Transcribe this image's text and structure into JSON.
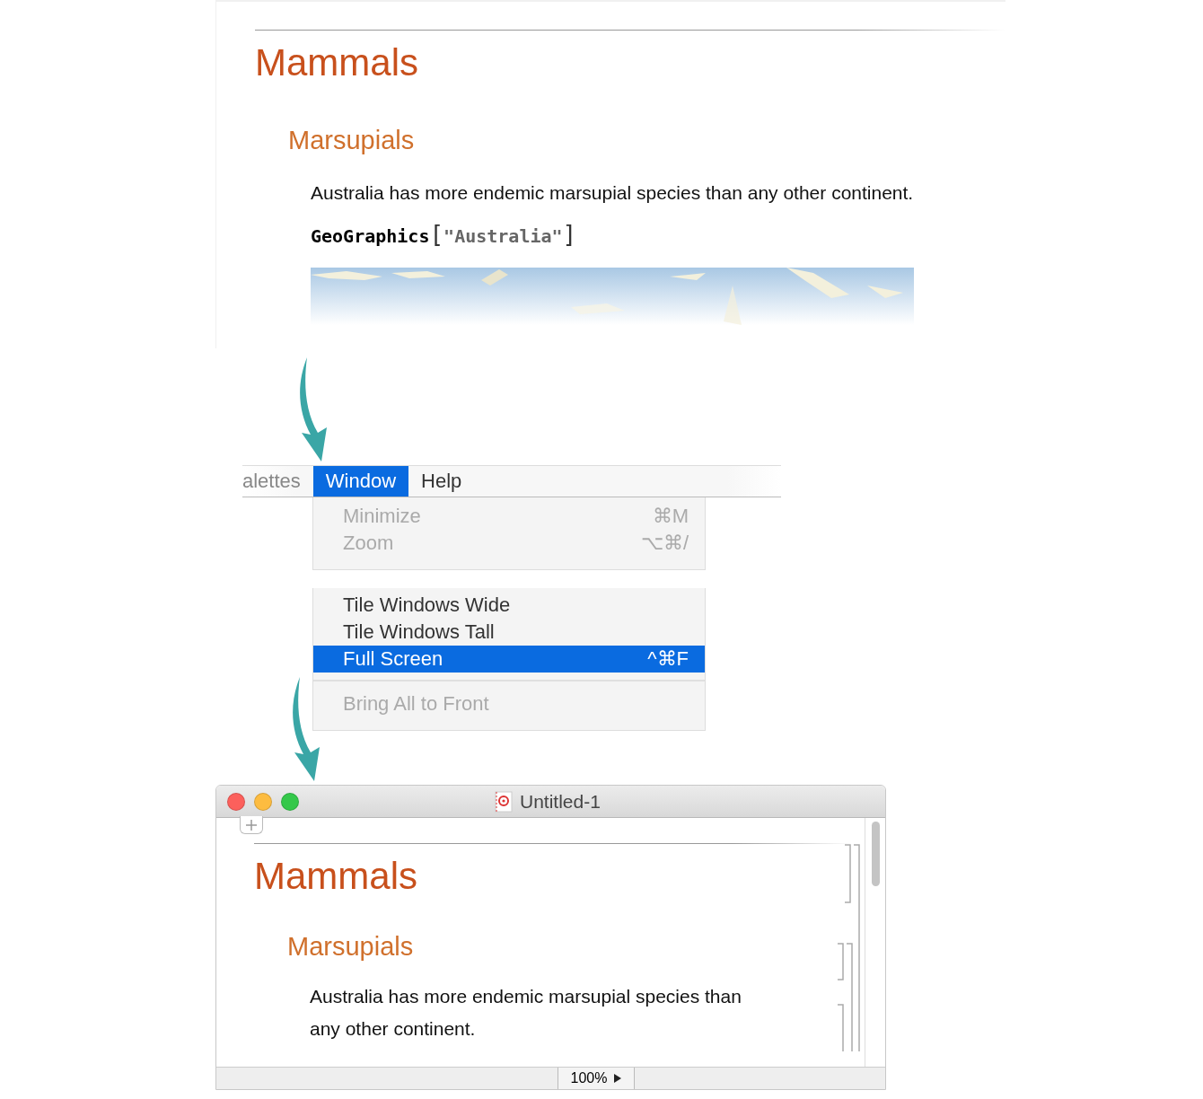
{
  "notebook": {
    "title": "Mammals",
    "section": "Marsupials",
    "text": "Australia has more endemic marsupial species than any other continent.",
    "code": [
      {
        "kind": "symbol",
        "text": "GeoGraphics"
      },
      {
        "kind": "bracket",
        "text": "["
      },
      {
        "kind": "string",
        "text": "\"Australia\""
      },
      {
        "kind": "bracket",
        "text": "]"
      }
    ]
  },
  "menu_bar": [
    {
      "label": "alettes",
      "selected": false
    },
    {
      "label": "Window",
      "selected": true
    },
    {
      "label": "Help",
      "selected": false
    }
  ],
  "menu": {
    "groups": [
      [
        {
          "kind": "item",
          "label": "Minimize",
          "shortcut": "⌘M",
          "disabled": true,
          "selected": false
        },
        {
          "kind": "item",
          "label": "Zoom",
          "shortcut": "⌥⌘/",
          "disabled": true,
          "selected": false
        }
      ],
      [
        {
          "kind": "item",
          "label": "Tile Windows Wide",
          "disabled": false,
          "selected": false
        },
        {
          "kind": "item",
          "label": "Tile Windows Tall",
          "disabled": false,
          "selected": false
        },
        {
          "kind": "item",
          "label": "Full Screen",
          "shortcut": "^⌘F",
          "disabled": false,
          "selected": true
        },
        {
          "kind": "separator"
        },
        {
          "kind": "item",
          "label": "Bring All to Front",
          "disabled": true,
          "selected": false
        }
      ]
    ]
  },
  "window": {
    "title": "Untitled-1",
    "zoom": "100%",
    "cells": [
      {
        "kind": "title",
        "text": "Mammals"
      },
      {
        "kind": "section",
        "text": "Marsupials"
      },
      {
        "kind": "text",
        "text": "Australia has more endemic marsupial species than any other continent."
      }
    ]
  }
}
